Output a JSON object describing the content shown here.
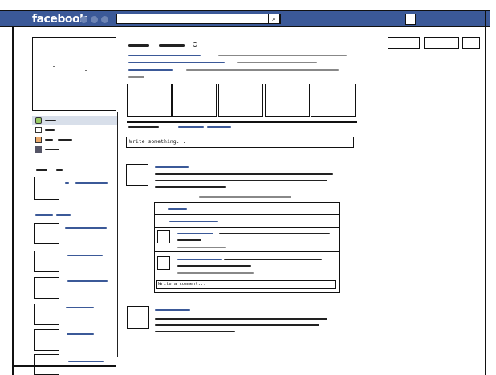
{
  "header": {
    "logo_text": "facebook",
    "search_placeholder": "",
    "search_icon": "magnifier-icon",
    "top_right_icon": "square-icon"
  },
  "composer": {
    "placeholder": "Write something..."
  },
  "comment_box": {
    "placeholder": "Write a comment..."
  },
  "colors": {
    "brand_blue": "#3b5998",
    "nav_highlight": "#d8dfea",
    "ink": "#111111"
  },
  "sidebar": {
    "nav_icons": [
      "speech-bubble-icon",
      "photo-icon",
      "folder-icon",
      "friends-icon"
    ],
    "sections": [
      "friends-section",
      "groups-section"
    ]
  }
}
